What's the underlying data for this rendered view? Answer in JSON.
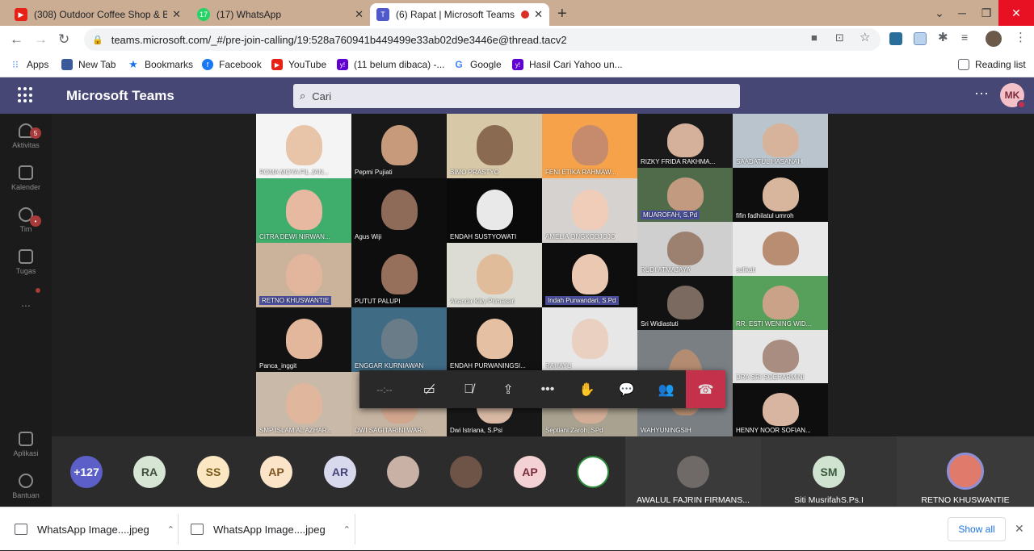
{
  "browser": {
    "tabs": [
      {
        "title": "(308) Outdoor Coffee Shop & Bo",
        "icon": "youtube-icon"
      },
      {
        "title": "(17) WhatsApp",
        "icon": "whatsapp-icon"
      },
      {
        "title": "(6) Rapat | Microsoft Teams",
        "icon": "teams-icon"
      }
    ],
    "url": "teams.microsoft.com/_#/pre-join-calling/19:528a760941b449499e33ab02d9e3446e@thread.tacv2",
    "bookmarks": [
      "Apps",
      "New Tab",
      "Bookmarks",
      "Facebook",
      "YouTube",
      "(11 belum dibaca) -...",
      "Google",
      "Hasil Cari Yahoo un..."
    ],
    "reading_list": "Reading list"
  },
  "teams": {
    "app_title": "Microsoft Teams",
    "search_placeholder": "Cari",
    "user_initials": "MK",
    "rail": [
      {
        "label": "Aktivitas",
        "badge": "5"
      },
      {
        "label": "Kalender",
        "badge": ""
      },
      {
        "label": "Tim",
        "badge": "•"
      },
      {
        "label": "Tugas",
        "badge": ""
      },
      {
        "label": "...",
        "badge": ""
      }
    ],
    "rail_bottom": [
      "Aplikasi",
      "Bantuan"
    ],
    "participants": [
      "ROMA MOYA FIL JAN...",
      "Pepmi Pujiati",
      "BIMO PRASTYO",
      "FENI ETIKA RAHMAW...",
      "RIZKY FRIDA RAKHMA...",
      "SAADATUL HASANAH",
      "MUAROFAH, S.Pd",
      "fifin fadhilatul umroh",
      "CITRA DEWI NIRWAN...",
      "Agus Wiji",
      "ENDAH SUSTYOWATI",
      "AMELIA ONGKODJOJO",
      "RUDI ATMAJAYA",
      "sulikah",
      "RETNO  KHUSWANTIE",
      "PUTUT PALUPI",
      "Ananda Kiky Primasari",
      "Indah Purwandari, S.Pd",
      "Sri Widiastuti",
      "RR. ESTI WENING WID...",
      "Panca_inggit",
      "ENGGAR KURNIAWAN",
      "ENDAH PURWANINGSI...",
      "RAHAYU",
      "DRA SRI SOEHARMINI",
      "SMP ISLAM AL AZHAR...",
      "DWI SAGITARINI WAR...",
      "Dwi Istriana, S.Psi",
      "Septiani Zaroh, SPd",
      "WAHYUNINGSIH",
      "HENNY NOOR SOFIAN..."
    ],
    "call_timer": "--:--",
    "roster_avatars": [
      "+127",
      "RA",
      "SS",
      "AP",
      "AR",
      "",
      "",
      "AP",
      ""
    ],
    "roster_tiles": [
      {
        "name": "AWALUL FAJRIN FIRMANS...",
        "initials": ""
      },
      {
        "name": "Siti MusrifahS.Ps.I",
        "initials": "SM"
      },
      {
        "name": "RETNO KHUSWANTIE",
        "initials": ""
      }
    ]
  },
  "downloads": {
    "items": [
      "WhatsApp Image....jpeg",
      "WhatsApp Image....jpeg"
    ],
    "show_all": "Show all"
  },
  "colors": {
    "teams_header": "#464775",
    "hangup": "#c4314b",
    "tab_strip": "#cbad94"
  }
}
